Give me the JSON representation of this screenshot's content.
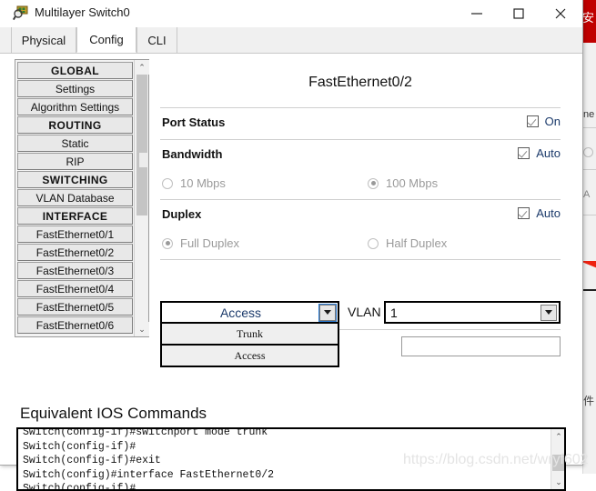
{
  "window": {
    "title": "Multilayer Switch0",
    "icon": "switch-magnifier-icon",
    "buttons": {
      "minimize": "—",
      "maximize": "□",
      "close": "✕"
    }
  },
  "tabs": [
    {
      "label": "Physical",
      "active": false
    },
    {
      "label": "Config",
      "active": true
    },
    {
      "label": "CLI",
      "active": false
    }
  ],
  "sidebar": {
    "items": [
      {
        "label": "GLOBAL",
        "header": true
      },
      {
        "label": "Settings",
        "header": false
      },
      {
        "label": "Algorithm Settings",
        "header": false
      },
      {
        "label": "ROUTING",
        "header": true
      },
      {
        "label": "Static",
        "header": false
      },
      {
        "label": "RIP",
        "header": false
      },
      {
        "label": "SWITCHING",
        "header": true
      },
      {
        "label": "VLAN Database",
        "header": false
      },
      {
        "label": "INTERFACE",
        "header": true
      },
      {
        "label": "FastEthernet0/1",
        "header": false
      },
      {
        "label": "FastEthernet0/2",
        "header": false
      },
      {
        "label": "FastEthernet0/3",
        "header": false
      },
      {
        "label": "FastEthernet0/4",
        "header": false
      },
      {
        "label": "FastEthernet0/5",
        "header": false
      },
      {
        "label": "FastEthernet0/6",
        "header": false
      }
    ],
    "scroll_up_glyph": "⌃",
    "scroll_down_glyph": "⌄"
  },
  "panel": {
    "title": "FastEthernet0/2",
    "port_status": {
      "label": "Port Status",
      "toggle_label": "On",
      "checked": true
    },
    "bandwidth": {
      "label": "Bandwidth",
      "toggle_label": "Auto",
      "checked": true,
      "options": [
        {
          "label": "10 Mbps",
          "selected": false
        },
        {
          "label": "100 Mbps",
          "selected": true
        }
      ]
    },
    "duplex": {
      "label": "Duplex",
      "toggle_label": "Auto",
      "checked": true,
      "options": [
        {
          "label": "Full Duplex",
          "selected": true
        },
        {
          "label": "Half Duplex",
          "selected": false
        }
      ]
    },
    "mode_combo": {
      "value": "Access",
      "expanded": true,
      "options": [
        "Trunk",
        "Access"
      ]
    },
    "vlan": {
      "label": "VLAN",
      "value": "1"
    },
    "lower_input": {
      "value": "",
      "placeholder": ""
    }
  },
  "ios": {
    "title": "Equivalent IOS Commands",
    "text": "Switch(config-if)#switchport mode trunk\nSwitch(config-if)#\nSwitch(config-if)#exit\nSwitch(config)#interface FastEthernet0/2\nSwitch(config-if)#",
    "scroll_up_glyph": "⌃",
    "scroll_down_glyph": "⌄"
  },
  "watermark": {
    "text": "https://blog.csdn.net/wryf602",
    "tail": "602"
  },
  "background": {
    "banner_glyph": "安",
    "text_a": "ne",
    "text_b": "A",
    "text_c": "件",
    "red": "#c00000",
    "arrow_red": "#ee2211"
  },
  "colors": {
    "accent_blue": "#1b3a6b",
    "window_border": "#a7a7a7",
    "tab_bg": "#f0f0f0",
    "sidebar_item_bg": "#e8e8e8",
    "text": "#111111"
  }
}
